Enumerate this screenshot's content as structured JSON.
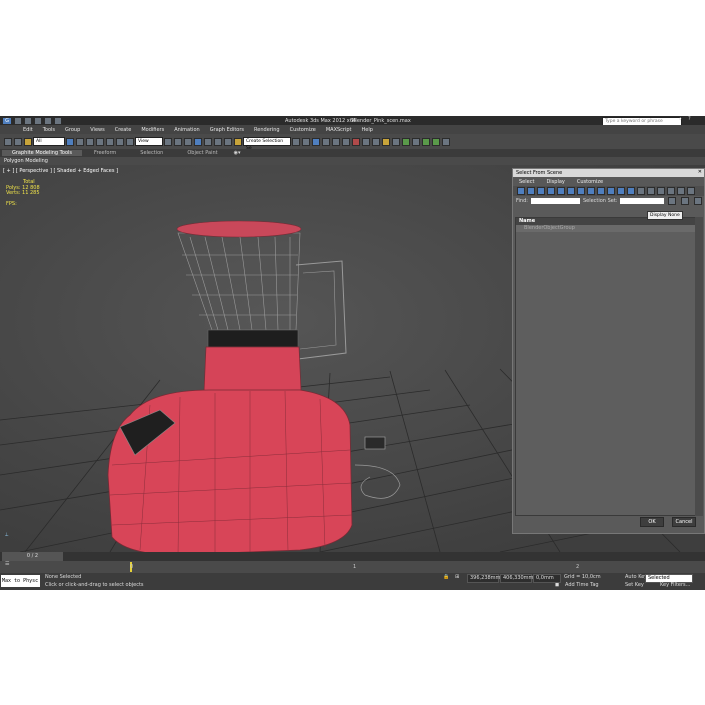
{
  "title_bar": {
    "app_title": "Autodesk 3ds Max 2012 x64",
    "file_name": "Blender_Pink_scen.max",
    "search_placeholder": "Type a keyword or phrase"
  },
  "menu": [
    "Edit",
    "Tools",
    "Group",
    "Views",
    "Create",
    "Modifiers",
    "Animation",
    "Graph Editors",
    "Rendering",
    "Customize",
    "MAXScript",
    "Help"
  ],
  "toolbar": {
    "filter_value": "All",
    "view_value": "View",
    "selection_set_value": "Create Selection Se"
  },
  "ribbon": {
    "tabs": [
      "Graphite Modeling Tools",
      "Freeform",
      "Selection",
      "Object Paint"
    ],
    "active_tab": "Graphite Modeling Tools",
    "subpanel": "Polygon Modeling"
  },
  "viewport": {
    "label": "[ + ] [ Perspective ] [ Shaded + Edged Faces ]",
    "stats": {
      "total_label": "Total",
      "polys_label": "Polys:",
      "polys_value": "12 808",
      "verts_label": "Verts:",
      "verts_value": "11 285",
      "fps_label": "FPS:"
    }
  },
  "dialog": {
    "title": "Select From Scene",
    "menu": [
      "Select",
      "Display",
      "Customize"
    ],
    "find_label": "Find:",
    "selection_set_label": "Selection Set:",
    "tooltip": "Display None",
    "column_header": "Name",
    "items": [
      "BlenderObjectGroup"
    ],
    "ok_label": "OK",
    "cancel_label": "Cancel"
  },
  "timeline": {
    "frame_counter": "0 / 2",
    "tick_labels": [
      "0",
      "1",
      "2"
    ]
  },
  "status": {
    "script_box": "Max to Physc",
    "selection_info": "None Selected",
    "prompt": "Click or click-and-drag to select objects",
    "x_value": "396,238mm",
    "y_value": "406,330mm",
    "z_value": "0,0mm",
    "grid": "Grid = 10,0cm",
    "add_time_tag": "Add Time Tag",
    "auto_key": "Auto Key",
    "auto_key_value": "Selected",
    "set_key": "Set Key",
    "key_filters": "Key Filters..."
  }
}
